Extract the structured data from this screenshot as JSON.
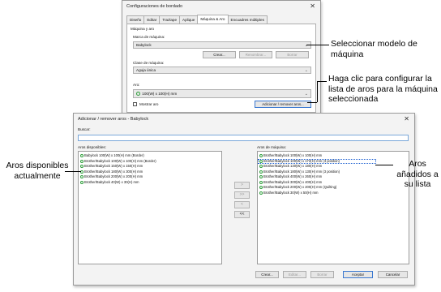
{
  "top_dialog": {
    "title": "Configuraciones de bordado",
    "close": "✕",
    "tabs": [
      {
        "label": "Diseño",
        "active": false
      },
      {
        "label": "Editar",
        "active": false
      },
      {
        "label": "Trazlape",
        "active": false
      },
      {
        "label": "Aplique",
        "active": false
      },
      {
        "label": "Máquina & Aro",
        "active": true
      },
      {
        "label": "Encuadres múltiples",
        "active": false
      }
    ],
    "group_label": "Máquina y aro",
    "machine_brand_label": "Marca de máquina:",
    "machine_brand_value": "Babylock",
    "btn_crear": "Crear...",
    "btn_renombrar": "Renombrar...",
    "btn_borrar": "Borrar",
    "machine_class_label": "Clase de máquina:",
    "machine_class_value": "Aguja única",
    "hoop_label": "Aro:",
    "hoop_value": "100(W) x 100(H) mm",
    "show_hoop_label": "Mostrar aro",
    "btn_add_remove": "Adicionar / remover aros..."
  },
  "bottom_dialog": {
    "title": "Adicionar / remover aros - Babylock",
    "close": "✕",
    "search_label": "Buscar:",
    "search_value": "",
    "available_label": "Aros disponibles:",
    "available_items": [
      "Babylock 100(W) x 100(H) mm (Border)",
      "Brother/Babylock 100(W) x 100(H) mm (Border)",
      "Brother/Babylock 150(W) x 150(H) mm",
      "Brother/Babylock 180(W) x 300(H) mm",
      "Brother/Babylock 200(W) x 200(H) mm",
      "Brother/Babylock 40(W) x 30(H) mm"
    ],
    "machine_label": "Aros de máquina:",
    "machine_items": [
      "Brother/Babylock 100(W) x 100(H) mm",
      "Brother/Babylock 100(W) x 172(H) mm (3 position)",
      "Brother/Babylock 130(W) x 180(H) mm",
      "Brother/Babylock 180(W) x 130(H) mm (3 position)",
      "Brother/Babylock 400(W) x 260(H) mm",
      "Brother/Babylock 300(W) x 400(H) mm",
      "Brother/Babylock 200(W) x 200(H) mm (Quilting)",
      "Brother/Babylock 30(W) x 50(H) mm"
    ],
    "selected_index": 1,
    "arrow_buttons": [
      ">",
      ">>",
      "<",
      "<<"
    ],
    "btn_crear": "Crear...",
    "btn_editar": "Editar...",
    "btn_borrar": "Borrar",
    "btn_aceptar": "Aceptar",
    "btn_cancelar": "Cancelar"
  },
  "callouts": {
    "select_model": "Seleccionar modelo de máquina",
    "click_configure": "Haga clic para configurar la lista de aros para la máquina seleccionada",
    "available_hoops": "Aros disponibles actualmente",
    "added_hoops": "Aros añadidos a su lista"
  },
  "colors": {
    "hoop_icon": "#2e9e3a",
    "selection_outline": "#1c5fd1"
  }
}
